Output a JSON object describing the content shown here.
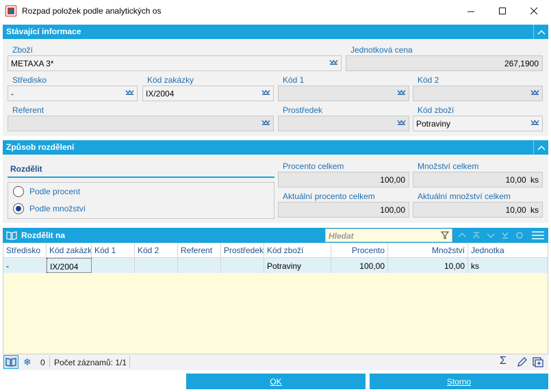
{
  "window": {
    "title": "Rozpad položek podle analytických os"
  },
  "sections": {
    "current_info": "Stávající informace",
    "split_method": "Způsob rozdělení",
    "split_on": "Rozdělit na"
  },
  "current_info": {
    "zbozi_label": "Zboží",
    "zbozi_value": "METAXA 3*",
    "unit_price_label": "Jednotková cena",
    "unit_price_value": "267,1900",
    "stredisko_label": "Středisko",
    "stredisko_value": "-",
    "kod_zakazky_label": "Kód zakázky",
    "kod_zakazky_value": "IX/2004",
    "kod1_label": "Kód 1",
    "kod1_value": "",
    "kod2_label": "Kód 2",
    "kod2_value": "",
    "referent_label": "Referent",
    "referent_value": "",
    "prostredek_label": "Prostředek",
    "prostredek_value": "",
    "kod_zbozi_label": "Kód zboží",
    "kod_zbozi_value": "Potraviny"
  },
  "split": {
    "group_title": "Rozdělit",
    "option_percent": "Podle procent",
    "option_quantity": "Podle množství",
    "selected": "quantity",
    "procento_celkem_label": "Procento celkem",
    "procento_celkem_value": "100,00",
    "mnozstvi_celkem_label": "Množství celkem",
    "mnozstvi_celkem_value": "10,00",
    "aktualni_procento_label": "Aktuální procento celkem",
    "aktualni_procento_value": "100,00",
    "aktualni_mnozstvi_label": "Aktuální množství celkem",
    "aktualni_mnozstvi_value": "10,00",
    "unit": "ks"
  },
  "grid": {
    "search_placeholder": "Hledat",
    "columns": [
      "Středisko",
      "Kód zakázky",
      "Kód 1",
      "Kód 2",
      "Referent",
      "Prostředek",
      "Kód zboží",
      "Procento",
      "Množství",
      "Jednotka"
    ],
    "rows": [
      [
        "-",
        "IX/2004",
        "",
        "",
        "",
        "",
        "Potraviny",
        "100,00",
        "10,00",
        "ks"
      ]
    ]
  },
  "status": {
    "filter_count": "0",
    "record_count": "Počet záznamů: 1/1"
  },
  "buttons": {
    "ok": "OK",
    "cancel": "Storno"
  },
  "colors": {
    "accent": "#1aa3dc",
    "grid_bg": "#fffbdb",
    "row_selected": "#dff0f7"
  }
}
